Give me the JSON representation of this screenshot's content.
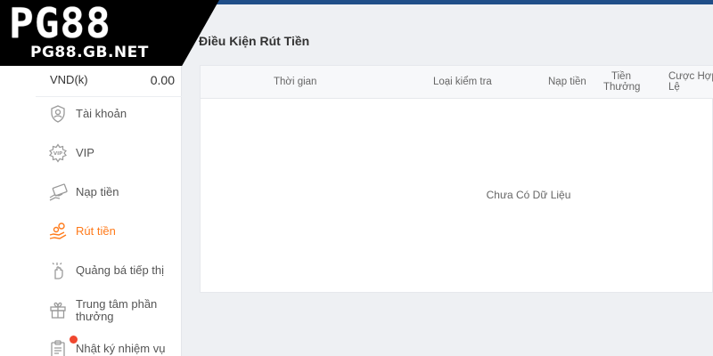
{
  "brand": {
    "logo_main": "PG88",
    "logo_sub": "PG88.GB.NET"
  },
  "sidebar": {
    "balance": {
      "currency": "VND(k)",
      "amount": "0.00"
    },
    "items": [
      {
        "label": "Tài khoản",
        "icon": "user-shield-icon",
        "active": false
      },
      {
        "label": "VIP",
        "icon": "vip-badge-icon",
        "active": false
      },
      {
        "label": "Nạp tiền",
        "icon": "deposit-money-icon",
        "active": false
      },
      {
        "label": "Rút tiền",
        "icon": "withdraw-hand-icon",
        "active": true
      },
      {
        "label": "Quảng bá tiếp thị",
        "icon": "promo-hand-icon",
        "active": false
      },
      {
        "label": "Trung tâm phần thưởng",
        "icon": "gift-icon",
        "active": false
      },
      {
        "label": "Nhật ký nhiệm vụ",
        "icon": "clipboard-icon",
        "active": false
      }
    ]
  },
  "main": {
    "title": "Điều Kiện Rút Tiền",
    "table": {
      "columns": [
        "Thời gian",
        "Loại kiểm tra",
        "Nạp tiền",
        "Tiền Thưởng",
        "Cược Hợp Lệ"
      ],
      "empty_text": "Chưa Có Dữ Liệu"
    }
  },
  "colors": {
    "accent": "#ff7a1a",
    "topbar": "#1f4e88",
    "notification_dot": "#f0472f"
  }
}
